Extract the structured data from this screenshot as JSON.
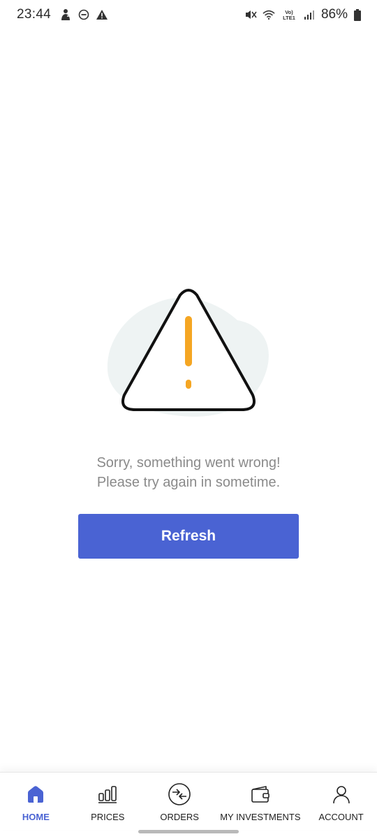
{
  "status_bar": {
    "time": "23:44",
    "battery": "86%",
    "network_label": "Vo) LTE1",
    "left_icons": [
      "user-alert-icon",
      "do-not-disturb-icon",
      "warning-icon"
    ],
    "right_icons": [
      "mute-icon",
      "wifi-icon",
      "lte-icon",
      "signal-icon",
      "battery-icon"
    ]
  },
  "error": {
    "line1": "Sorry, something went wrong!",
    "line2": "Please try again in sometime.",
    "illustration": "warning-triangle-icon"
  },
  "refresh_button": {
    "label": "Refresh"
  },
  "bottom_nav": {
    "items": [
      {
        "label": "HOME",
        "icon": "home-icon",
        "active": true
      },
      {
        "label": "PRICES",
        "icon": "bar-chart-icon",
        "active": false
      },
      {
        "label": "ORDERS",
        "icon": "exchange-icon",
        "active": false
      },
      {
        "label": "MY INVESTMENTS",
        "icon": "wallet-icon",
        "active": false
      },
      {
        "label": "ACCOUNT",
        "icon": "person-icon",
        "active": false
      }
    ]
  },
  "colors": {
    "accent": "#4a63d3",
    "warning": "#f5a623",
    "text_muted": "#8a8a8a",
    "blob": "#eef3f3"
  }
}
